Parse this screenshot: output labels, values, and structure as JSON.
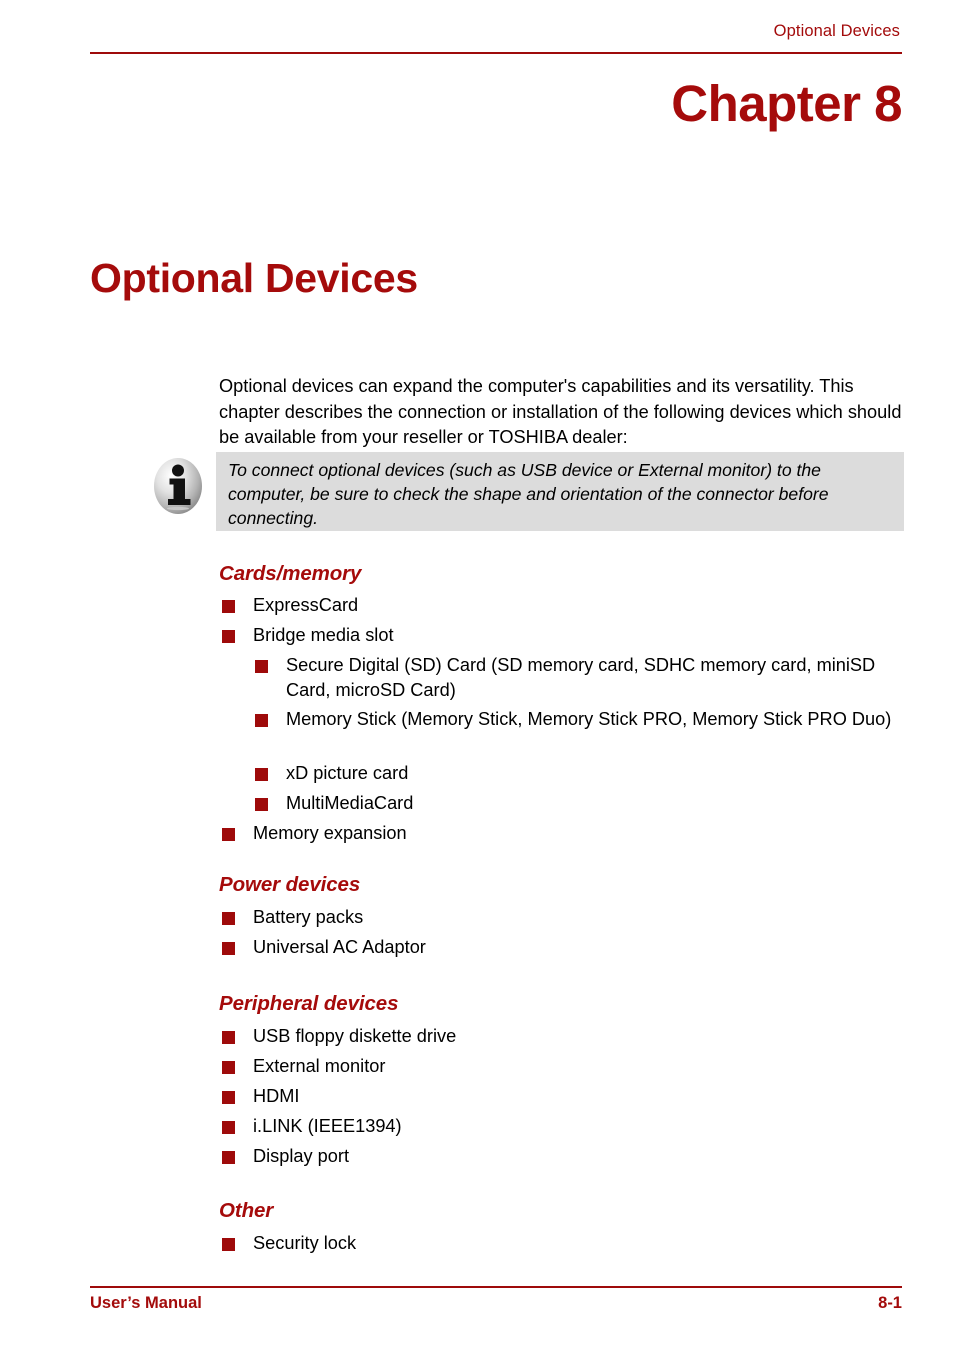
{
  "header": {
    "running_title": "Optional Devices"
  },
  "chapter": {
    "number_label": "Chapter 8",
    "title": "Optional Devices"
  },
  "intro": {
    "paragraph": "Optional devices can expand the computer's capabilities and its versatility. This chapter describes the connection or installation of the following devices which should be available from your reseller or TOSHIBA dealer:"
  },
  "note": {
    "icon": "info-icon",
    "text": "To connect optional devices (such as USB device or External monitor) to the computer, be sure to check the shape and orientation of the connector before connecting."
  },
  "sections": [
    {
      "heading": "Cards/memory",
      "items": [
        {
          "label": "ExpressCard",
          "level": 1
        },
        {
          "label": "Bridge media slot",
          "level": 1
        },
        {
          "label": "Secure Digital (SD) Card (SD memory card, SDHC memory card, miniSD Card, microSD Card)",
          "level": 2
        },
        {
          "label": "Memory Stick (Memory Stick, Memory Stick PRO, Memory Stick PRO Duo)",
          "level": 2
        },
        {
          "label": "xD picture card",
          "level": 2
        },
        {
          "label": "MultiMediaCard",
          "level": 2
        },
        {
          "label": "Memory expansion",
          "level": 1
        }
      ]
    },
    {
      "heading": "Power devices",
      "items": [
        {
          "label": "Battery packs",
          "level": 1
        },
        {
          "label": "Universal AC Adaptor",
          "level": 1
        }
      ]
    },
    {
      "heading": "Peripheral devices",
      "items": [
        {
          "label": "USB floppy diskette drive",
          "level": 1
        },
        {
          "label": "External monitor",
          "level": 1
        },
        {
          "label": "HDMI",
          "level": 1
        },
        {
          "label": "i.LINK (IEEE1394)",
          "level": 1
        },
        {
          "label": "Display port",
          "level": 1
        }
      ]
    },
    {
      "heading": "Other",
      "items": [
        {
          "label": "Security lock",
          "level": 1
        }
      ]
    }
  ],
  "footer": {
    "left": "User’s Manual",
    "right": "8-1"
  },
  "colors": {
    "accent_red": "#a50b0b",
    "rule_red": "#9e0a0a",
    "bullet_red": "#9e0a0a",
    "note_background": "#dcdcdc",
    "body_text": "#000000"
  }
}
